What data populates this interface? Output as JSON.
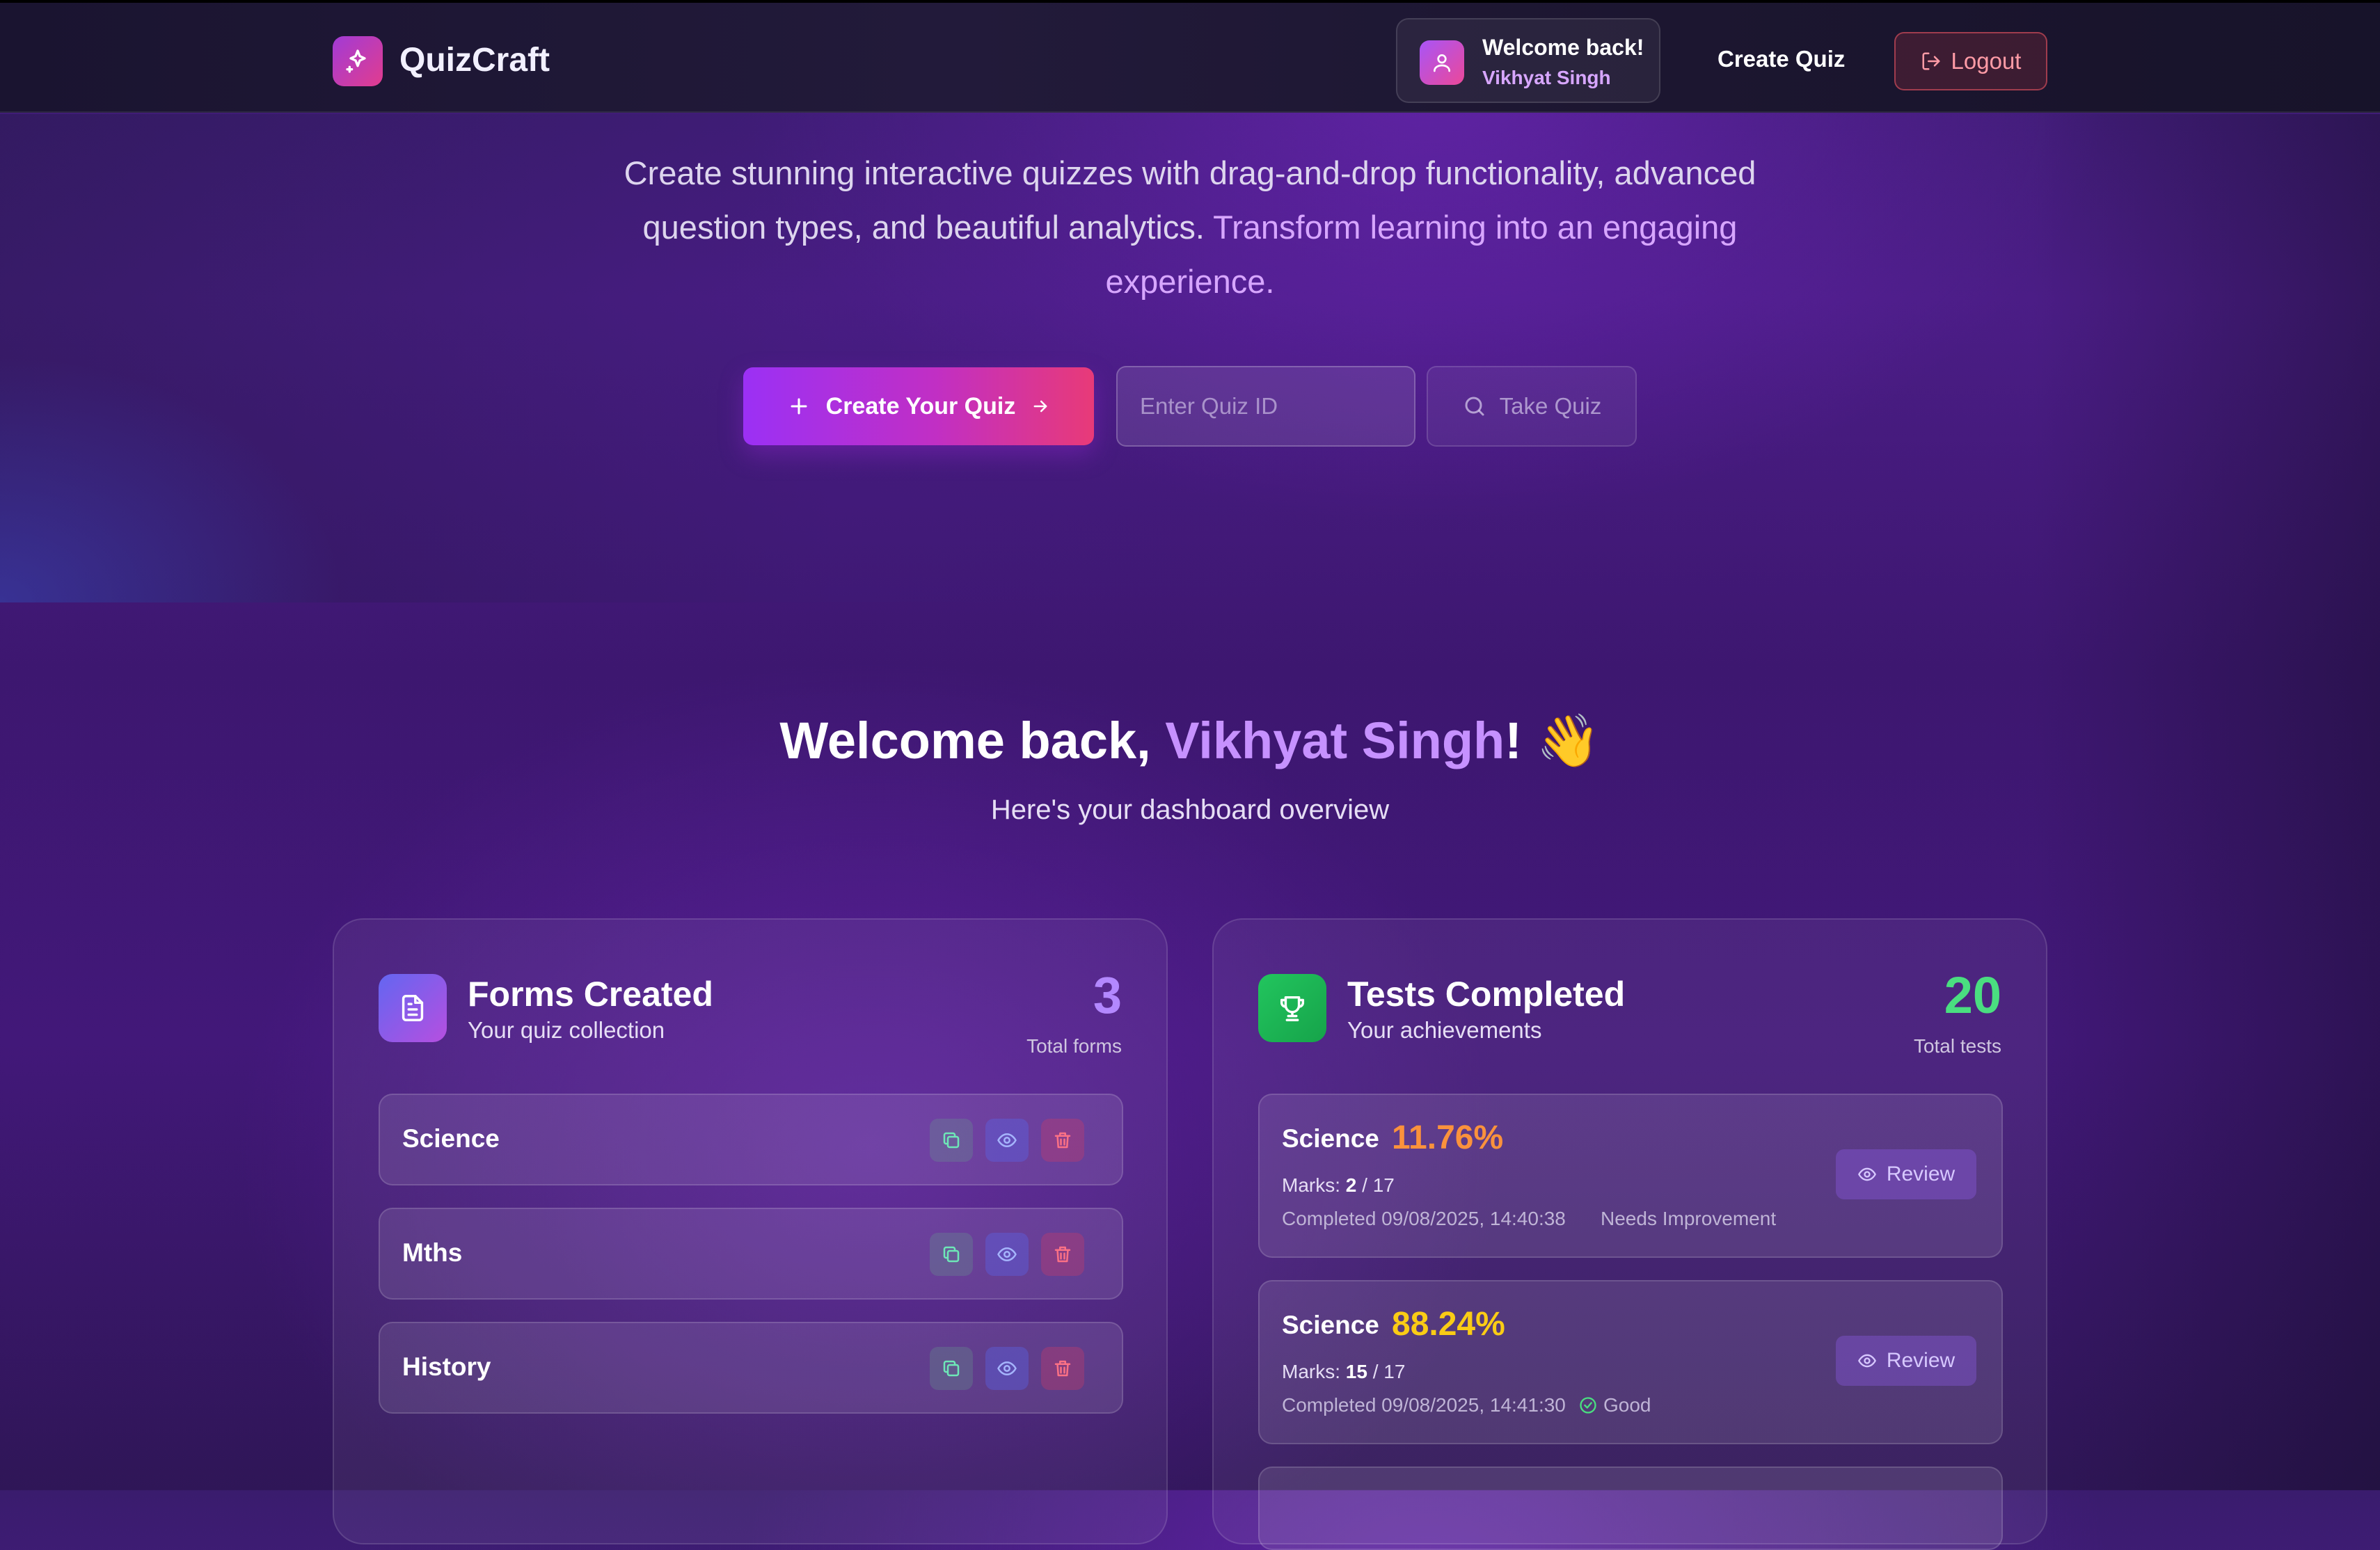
{
  "nav": {
    "brand": "QuizCraft",
    "welcome_title": "Welcome back!",
    "welcome_name": "Vikhyat Singh",
    "create_quiz": "Create Quiz",
    "logout": "Logout"
  },
  "hero": {
    "text_plain": "Create stunning interactive quizzes with drag-and-drop functionality, advanced question types, and beautiful analytics.",
    "text_accent": "Transform learning into an engaging experience.",
    "create_button": "Create Your Quiz",
    "quiz_id_placeholder": "Enter Quiz ID",
    "take_quiz": "Take Quiz"
  },
  "dashboard": {
    "greeting": "Welcome back,",
    "name": "Vikhyat Singh",
    "greeting_suffix": "! 👋",
    "subtitle": "Here's your dashboard overview"
  },
  "forms_panel": {
    "title": "Forms Created",
    "subtitle": "Your quiz collection",
    "count": "3",
    "count_label": "Total forms",
    "forms": [
      {
        "name": "Science"
      },
      {
        "name": "Mths"
      },
      {
        "name": "History"
      }
    ]
  },
  "tests_panel": {
    "title": "Tests Completed",
    "subtitle": "Your achievements",
    "count": "20",
    "count_label": "Total tests",
    "marks_label": "Marks:",
    "review_label": "Review",
    "tests": [
      {
        "subject": "Science",
        "percent": "11.76%",
        "score": "2",
        "total": "/ 17",
        "completed": "Completed 09/08/2025, 14:40:38",
        "status": "Needs Improvement",
        "percent_color": "#fb923c"
      },
      {
        "subject": "Science",
        "percent": "88.24%",
        "score": "15",
        "total": "/ 17",
        "completed": "Completed 09/08/2025, 14:41:30",
        "status": "Good",
        "percent_color": "#facc15"
      }
    ]
  },
  "colors": {
    "accent_purple": "#9b30f5",
    "accent_pink": "#e83a78",
    "success_green": "#4ade80"
  }
}
